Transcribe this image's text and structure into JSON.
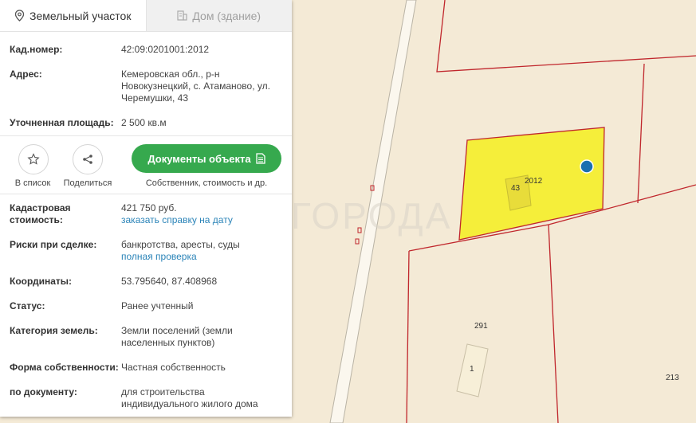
{
  "tabs": [
    {
      "label": "Земельный участок",
      "icon": "map-pin-icon",
      "active": true
    },
    {
      "label": "Дом (здание)",
      "icon": "building-icon",
      "active": false
    }
  ],
  "info": {
    "cad_number": {
      "label": "Кад.номер:",
      "value": "42:09:0201001:2012"
    },
    "address": {
      "label": "Адрес:",
      "value": "Кемеровская обл., р-н Новокузнецкий, с. Атаманово, ул. Черемушки, 43"
    },
    "area": {
      "label": "Уточненная площадь:",
      "value": "2 500 кв.м"
    }
  },
  "actions": {
    "favorite_label": "В список",
    "share_label": "Поделиться",
    "docs_button": "Документы объекта",
    "docs_caption": "Собственник, стоимость и др."
  },
  "details": {
    "cad_cost": {
      "label": "Кадастровая стоимость:",
      "value": "421 750 руб.",
      "link": "заказать справку на дату"
    },
    "risks": {
      "label": "Риски при сделке:",
      "value": "банкротства, аресты, суды",
      "link": "полная проверка"
    },
    "coords": {
      "label": "Координаты:",
      "value": "53.795640, 87.408968"
    },
    "status": {
      "label": "Статус:",
      "value": "Ранее учтенный"
    },
    "category": {
      "label": "Категория земель:",
      "value": "Земли поселений (земли населенных пунктов)"
    },
    "ownership": {
      "label": "Форма собственности:",
      "value": "Частная собственность"
    },
    "by_document": {
      "label": "по документу:",
      "value": "для строительства индивидуального жилого дома"
    }
  },
  "map": {
    "parcel_label": "2012",
    "house_label": "43",
    "parcel_291": "291",
    "parcel_213": "213",
    "building_1": "1",
    "watermark": "ГОРОДА",
    "colors": {
      "background": "#f4ead6",
      "boundary": "#c0262c",
      "selected_fill": "#f5ee3a",
      "marker": "#1a6fb0"
    }
  }
}
